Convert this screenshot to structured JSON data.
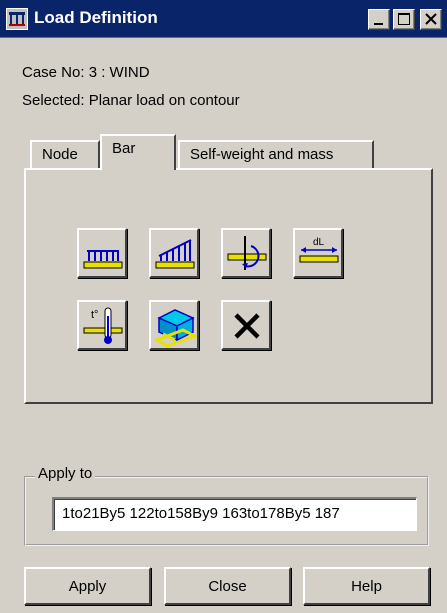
{
  "window": {
    "title": "Load Definition",
    "controls": [
      "minimize",
      "maximize",
      "close"
    ]
  },
  "info": {
    "case_line": "Case No: 3 : WIND",
    "selected_line": "Selected:  Planar load on contour"
  },
  "tabs": [
    {
      "label": "Node",
      "active": false
    },
    {
      "label": "Bar",
      "active": true
    },
    {
      "label": "Self-weight and mass",
      "active": false
    }
  ],
  "tools": {
    "row1": [
      "uniform-load-icon",
      "trapezoidal-load-icon",
      "moment-load-icon",
      "dl-expansion-icon"
    ],
    "row2": [
      "thermal-load-icon",
      "self-weight-3d-icon",
      "delete-icon"
    ],
    "dl_text": "dL",
    "thermal_text": "t°"
  },
  "apply_to": {
    "label": "Apply to",
    "value": "1to21By5 122to158By9 163to178By5 187"
  },
  "buttons": {
    "apply": "Apply",
    "close": "Close",
    "help": "Help"
  },
  "colors": {
    "titlebar": "#0a246a",
    "face": "#d4d0c8",
    "load_blue": "#0000c8",
    "beam_yellow": "#e8e000",
    "cube_cyan": "#00c8e8"
  }
}
